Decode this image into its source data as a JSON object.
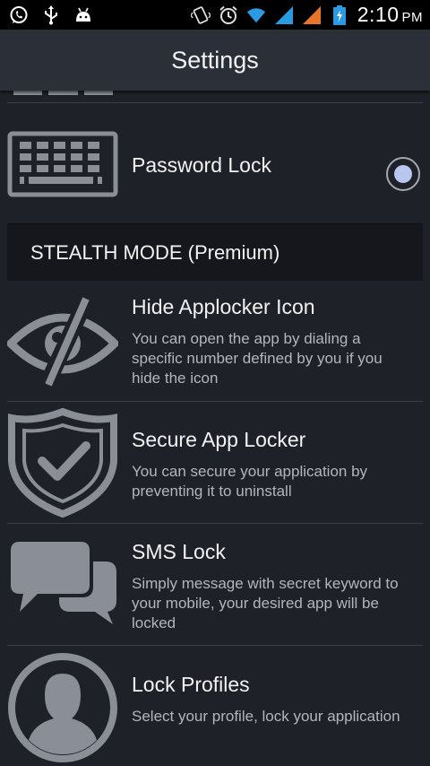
{
  "status_bar": {
    "time": "2:10",
    "ampm": "PM",
    "left_icons": [
      "whatsapp-icon",
      "usb-icon",
      "android-icon"
    ],
    "right_icons": [
      "vibrate-icon",
      "alarm-icon",
      "wifi-icon",
      "signal-icon",
      "signal-icon",
      "battery-charging-icon"
    ]
  },
  "header": {
    "title": "Settings"
  },
  "password_lock": {
    "title": "Password Lock",
    "icon": "keyboard-icon",
    "selected": true
  },
  "section": {
    "title": "STEALTH MODE (Premium)"
  },
  "items": [
    {
      "title": "Hide Applocker Icon",
      "desc": "You can open the app by dialing a specific number defined by you if you hide the icon",
      "icon": "eye-slash-icon"
    },
    {
      "title": "Secure App Locker",
      "desc": "You can secure your application by preventing it to uninstall",
      "icon": "shield-check-icon"
    },
    {
      "title": "SMS Lock",
      "desc": "Simply message with secret keyword to your mobile, your desired app will be locked",
      "icon": "chat-bubbles-icon"
    },
    {
      "title": "Lock Profiles",
      "desc": "Select your profile, lock your application",
      "icon": "user-profile-icon"
    }
  ],
  "colors": {
    "background": "#1e2128",
    "action_bar": "#2b2f37",
    "section_header": "#15171c",
    "icon_gray": "#8a8e96",
    "radio_selected": "#b9c6ef"
  }
}
